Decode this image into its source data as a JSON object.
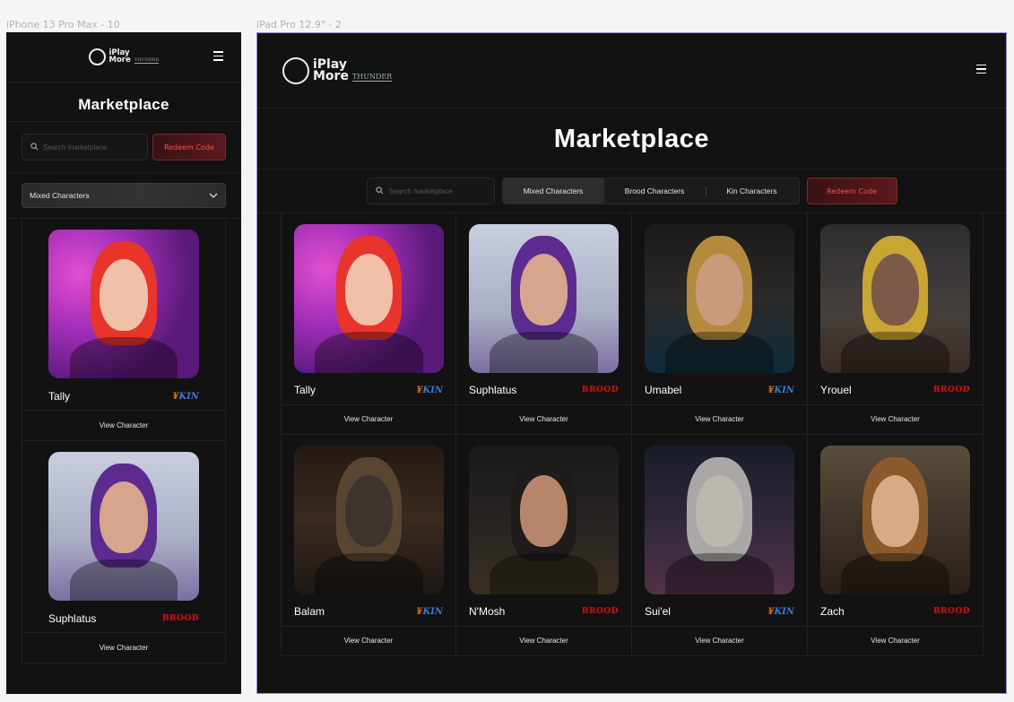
{
  "labels": {
    "phone_frame": "iPhone 13 Pro Max - 10",
    "tablet_frame": "iPad Pro 12.9\" - 2"
  },
  "brand": {
    "line1": "iPlay",
    "line2": "More",
    "partner": "THUNDER"
  },
  "page_title": "Marketplace",
  "search": {
    "placeholder": "Search marketplace"
  },
  "redeem_label": "Redeem Code",
  "dropdown_value": "Mixed Characters",
  "tabs": [
    {
      "label": "Mixed  Characters",
      "active": true
    },
    {
      "label": "Brood Characters",
      "active": false
    },
    {
      "label": "Kin Characters",
      "active": false
    }
  ],
  "view_label": "View Character",
  "colors": {
    "background": "#121212",
    "accent_red": "#ff4b4b",
    "kin_blue": "#3b7bd6",
    "brood_red": "#c01515"
  },
  "characters": [
    {
      "name": "Tally",
      "faction": "KIN",
      "faction_icon": "kin-logo-icon"
    },
    {
      "name": "Suphlatus",
      "faction": "BROOD",
      "faction_icon": "brood-logo-icon"
    },
    {
      "name": "Umabel",
      "faction": "KIN",
      "faction_icon": "kin-logo-icon"
    },
    {
      "name": "Yrouel",
      "faction": "BROOD",
      "faction_icon": "brood-logo-icon"
    },
    {
      "name": "Balam",
      "faction": "KIN",
      "faction_icon": "kin-logo-icon"
    },
    {
      "name": "N'Mosh",
      "faction": "BROOD",
      "faction_icon": "brood-logo-icon"
    },
    {
      "name": "Sui'el",
      "faction": "KIN",
      "faction_icon": "kin-logo-icon"
    },
    {
      "name": "Zach",
      "faction": "BROOD",
      "faction_icon": "brood-logo-icon"
    }
  ]
}
